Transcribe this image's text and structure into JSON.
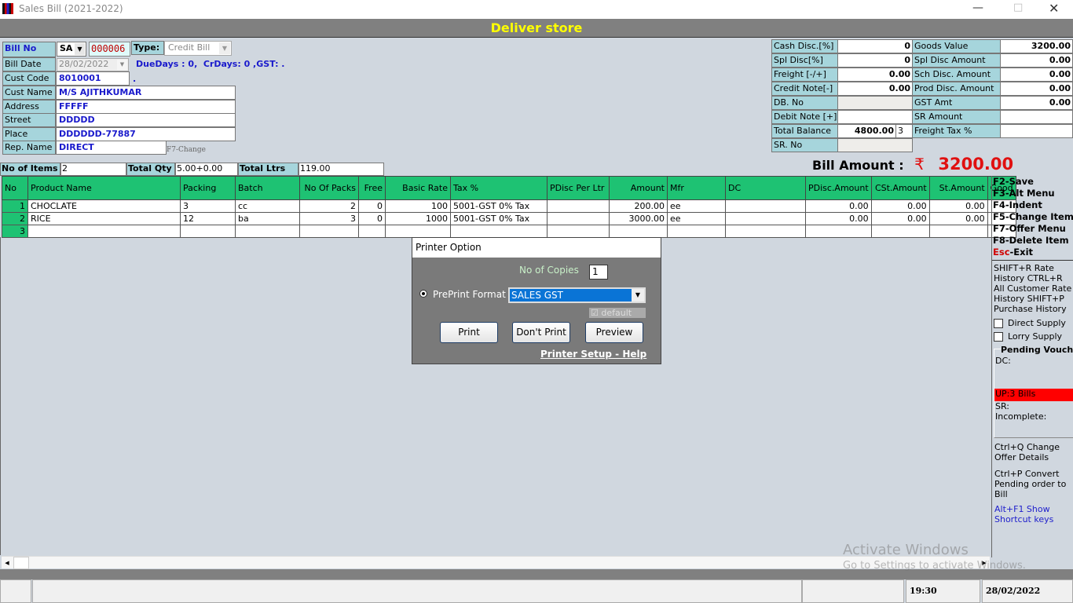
{
  "window": {
    "title": "Sales Bill (2021-2022)",
    "store": "Deliver store"
  },
  "bill": {
    "bill_no_label": "Bill No",
    "series": "SA",
    "number": "000006",
    "type_label": "Type:",
    "type": "Credit Bill",
    "bill_date_label": "Bill Date",
    "bill_date": "28/02/2022",
    "due_info": "DueDays : 0,  CrDays: 0 ,GST: .",
    "cust_code_label": "Cust Code",
    "cust_code": "8010001",
    "cust_code_extra": ".",
    "cust_name_label": "Cust Name",
    "cust_name": "M/S AJITHKUMAR",
    "address_label": "Address",
    "address": "FFFFF",
    "street_label": "Street",
    "street": "DDDDD",
    "place_label": "Place",
    "place": "DDDDDD-77887",
    "rep_label": "Rep. Name",
    "rep": "DIRECT",
    "rep_hint": "F7-Change"
  },
  "summary_left": [
    {
      "label": "Cash Disc.[%]",
      "value": "0"
    },
    {
      "label": "Spl Disc[%]",
      "value": "0"
    },
    {
      "label": "Freight [-/+]",
      "value": "0.00"
    },
    {
      "label": "Credit Note[-]",
      "value": "0.00"
    },
    {
      "label": "DB. No",
      "value": ""
    },
    {
      "label": "Debit Note [+]",
      "value": ""
    },
    {
      "label": "Total Balance",
      "value": "4800.00",
      "extra": "3"
    },
    {
      "label": "SR. No",
      "value": ""
    }
  ],
  "summary_right": [
    {
      "label": "Goods Value",
      "value": "3200.00"
    },
    {
      "label": "Spl Disc Amount",
      "value": "0.00"
    },
    {
      "label": "Sch  Disc. Amount",
      "value": "0.00"
    },
    {
      "label": "Prod Disc. Amount",
      "value": "0.00"
    },
    {
      "label": "GST Amt",
      "value": "0.00"
    },
    {
      "label": "SR Amount",
      "value": ""
    },
    {
      "label": "Freight Tax %",
      "value": ""
    }
  ],
  "bill_amount": {
    "label": "Bill Amount :",
    "currency": "₹",
    "value": "3200.00"
  },
  "totals": {
    "items_label": "No of Items",
    "items": "2",
    "qty_label": "Total Qty",
    "qty": "5.00+0.00",
    "ltrs_label": "Total Ltrs",
    "ltrs": "119.00"
  },
  "grid": {
    "columns": [
      "No",
      "Product Name",
      "Packing",
      "Batch",
      "No Of Packs",
      "Free",
      "Basic Rate",
      "Tax %",
      "PDisc Per Ltr",
      "Amount",
      "Mfr",
      "DC",
      "PDisc.Amount",
      "CSt.Amount",
      "St.Amount",
      "Good"
    ],
    "rows": [
      [
        "1",
        "CHOCLATE",
        "3",
        "cc",
        "2",
        "0",
        "100",
        "5001-GST 0% Tax",
        "",
        "200.00",
        "ee",
        "",
        "0.00",
        "0.00",
        "0.00",
        ""
      ],
      [
        "2",
        "RICE",
        "12",
        "ba",
        "3",
        "0",
        "1000",
        "5001-GST 0% Tax",
        "",
        "3000.00",
        "ee",
        "",
        "0.00",
        "0.00",
        "0.00",
        ""
      ],
      [
        "3",
        "",
        "",
        "",
        "",
        "",
        "",
        "",
        "",
        "",
        "",
        "",
        "",
        "",
        "",
        ""
      ]
    ]
  },
  "shortcuts": {
    "keys": [
      [
        "F2",
        "-Save"
      ],
      [
        "F3",
        "-Alt Menu"
      ],
      [
        "F4",
        "-Indent"
      ],
      [
        "F5",
        "-Change Item"
      ],
      [
        "F7",
        "-Offer Menu"
      ],
      [
        "F8",
        "-Delete Item"
      ],
      [
        "Esc",
        "-Exit"
      ]
    ],
    "history": "SHIFT+R Rate History CTRL+R All Customer Rate History SHIFT+P Purchase History",
    "direct_supply": "Direct Supply",
    "lorry_supply": "Lorry Supply",
    "pending_title": "Pending Vouchers",
    "dc": "DC:",
    "up": "UP:3 Bills",
    "sr": "SR:",
    "incomplete": "Incomplete:",
    "ctrl_q": "Ctrl+Q  Change Offer Details",
    "ctrl_p": "Ctrl+P  Convert Pending order to Bill",
    "alt_f1": "Alt+F1 Show Shortcut keys"
  },
  "dialog": {
    "title": "Printer Option",
    "copies_label": "No of Copies",
    "copies": "1",
    "format_label": "PrePrint Format",
    "format": "SALES GST",
    "default_label": "default",
    "print": "Print",
    "dont_print": "Don't Print",
    "preview": "Preview",
    "help": "Printer Setup - Help"
  },
  "watermark": {
    "line1": "Activate Windows",
    "line2": "Go to Settings to activate Windows."
  },
  "status": {
    "time": "19:30",
    "date": "28/02/2022"
  }
}
